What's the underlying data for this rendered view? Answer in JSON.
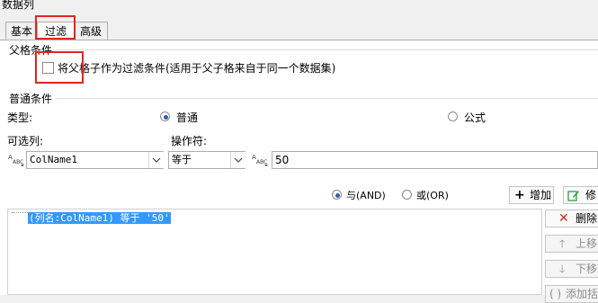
{
  "window": {
    "title": "数据列"
  },
  "tabs": [
    {
      "label": "基本"
    },
    {
      "label": "过滤"
    },
    {
      "label": "高级"
    }
  ],
  "parent_condition": {
    "section_title": "父格条件",
    "checkbox_label": "将父格子作为过滤条件(适用于父子格来自于同一个数据集)"
  },
  "normal_condition": {
    "section_title": "普通条件",
    "type_label": "类型:",
    "type_options": [
      "普通",
      "公式"
    ],
    "column_label": "可选列:",
    "operator_label": "操作符:",
    "column_value": "ColName1",
    "operator_value": "等于",
    "value": "50"
  },
  "logic": {
    "and_label": "与(AND)",
    "or_label": "或(OR)"
  },
  "buttons": {
    "add": "增加",
    "modify": "修",
    "delete": "删除",
    "move_up": "上移",
    "move_down": "下移",
    "add_bracket": "添加括"
  },
  "conditions": [
    "(列名:ColName1) 等于 '50'"
  ],
  "colors": {
    "accent": "#3399ff",
    "highlight_box": "#e1261c",
    "delete_icon": "#d9261c",
    "modify_icon": "#2e9e3e"
  }
}
